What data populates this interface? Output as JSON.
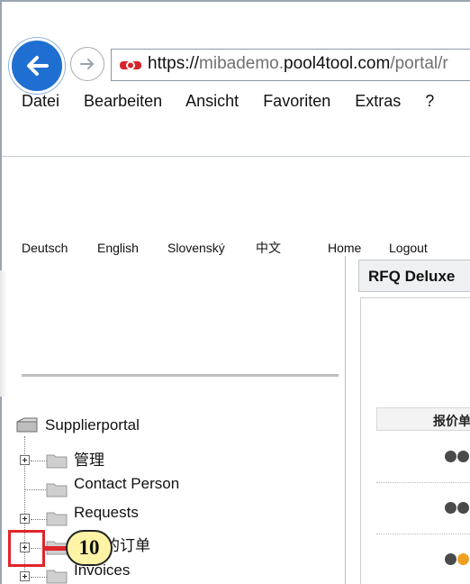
{
  "browser": {
    "url_prefix": "https://",
    "url_domain_sub": "mibademo.",
    "url_domain_main": "pool4tool.com",
    "url_path": "/portal/r",
    "menu": [
      "Datei",
      "Bearbeiten",
      "Ansicht",
      "Favoriten",
      "Extras",
      "?"
    ]
  },
  "langbar": {
    "languages": [
      "Deutsch",
      "English",
      "Slovenský",
      "中文"
    ],
    "home": "Home",
    "logout": "Logout"
  },
  "rfq": {
    "title": "RFQ Deluxe",
    "column_header": "报价单"
  },
  "tree": {
    "root": "Supplierportal",
    "items": [
      "管理",
      "Contact Person",
      "Requests",
      "确认的订单",
      "Invoices"
    ]
  },
  "callout": {
    "number": "10",
    "color": "#e0242b"
  }
}
